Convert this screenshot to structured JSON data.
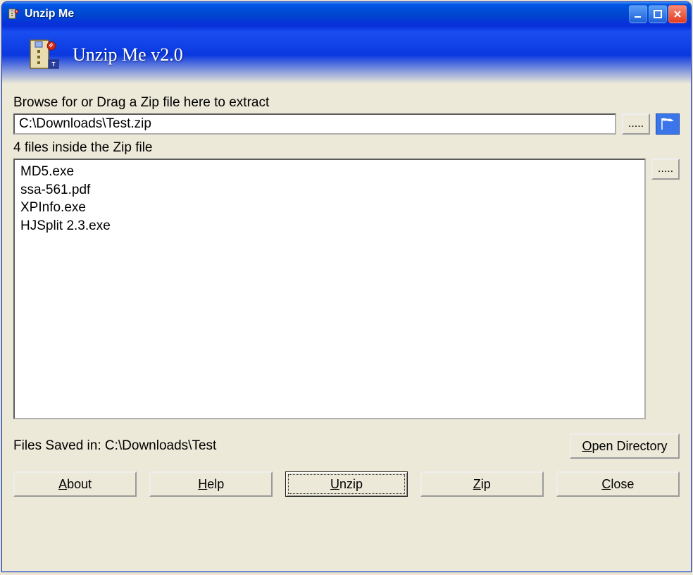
{
  "window": {
    "title": "Unzip Me"
  },
  "banner": {
    "title": "Unzip Me v2.0"
  },
  "browse": {
    "label": "Browse for or Drag a Zip file here to extract",
    "path": "C:\\Downloads\\Test.zip",
    "browseBtn": "....."
  },
  "filelist": {
    "label": "4 files inside the Zip file",
    "moreBtn": "....."
  },
  "files": [
    "MD5.exe",
    "ssa-561.pdf",
    "XPInfo.exe",
    "HJSplit 2.3.exe"
  ],
  "status": {
    "text": "Files Saved in: C:\\Downloads\\Test"
  },
  "buttons": {
    "openDir": "Open Directory",
    "about": "About",
    "help": "Help",
    "unzip": "Unzip",
    "zip": "Zip",
    "close": "Close"
  }
}
